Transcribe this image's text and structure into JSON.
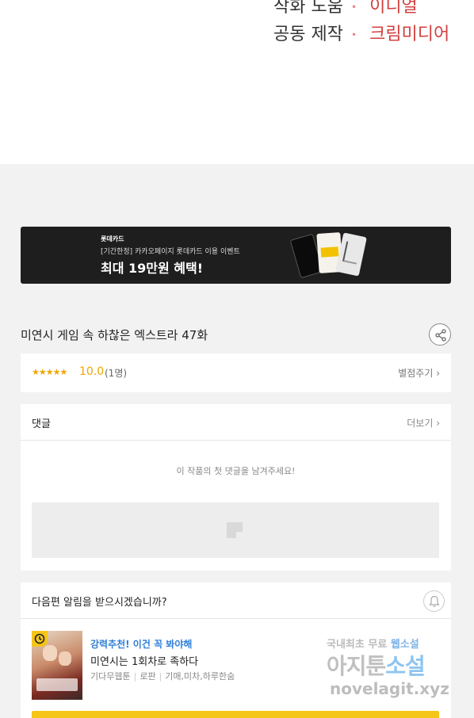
{
  "credits": {
    "rows": [
      {
        "role": "작화 도움",
        "name": "이디얼"
      },
      {
        "role": "공동 제작",
        "name": "크림미디어"
      }
    ]
  },
  "banner": {
    "brand": "롯데카드",
    "subtitle": "[기간한정] 카카오페이지 롯데카드 이용 이벤트",
    "headline": "최대 19만원 혜택!"
  },
  "episode": {
    "title": "미연시 게임 속 하찮은 엑스트라 47화",
    "share_icon": "share-icon"
  },
  "rating": {
    "stars": "★★★★★",
    "score": "10.0",
    "count": "(1명)",
    "rate_button": "별점주기 ›"
  },
  "comments": {
    "label": "댓글",
    "more": "더보기 ›",
    "empty_message": "이 작품의 첫 댓글을 남겨주세요!"
  },
  "notify": {
    "question": "다음편 알림을 받으시겠습니까?",
    "bell_icon": "bell-icon",
    "recommendation": {
      "tag": "강력추천! 이건 꼭 봐야해",
      "title": "미연시는 1회차로 족하다",
      "meta": [
        "기다무웹툰",
        "로판",
        "기매,미차,하루한숨"
      ]
    }
  },
  "watermark": {
    "line1_prefix": "국내최초 무료 ",
    "line1_highlight": "웹소설",
    "line2_prefix": "아지툰",
    "line2_highlight": "소설",
    "line3": "novelagit.xyz"
  },
  "colors": {
    "accent_yellow": "#f5c518",
    "rating_orange": "#f0a500",
    "credit_red": "#d2403f",
    "tag_blue": "#2f7fd8"
  }
}
